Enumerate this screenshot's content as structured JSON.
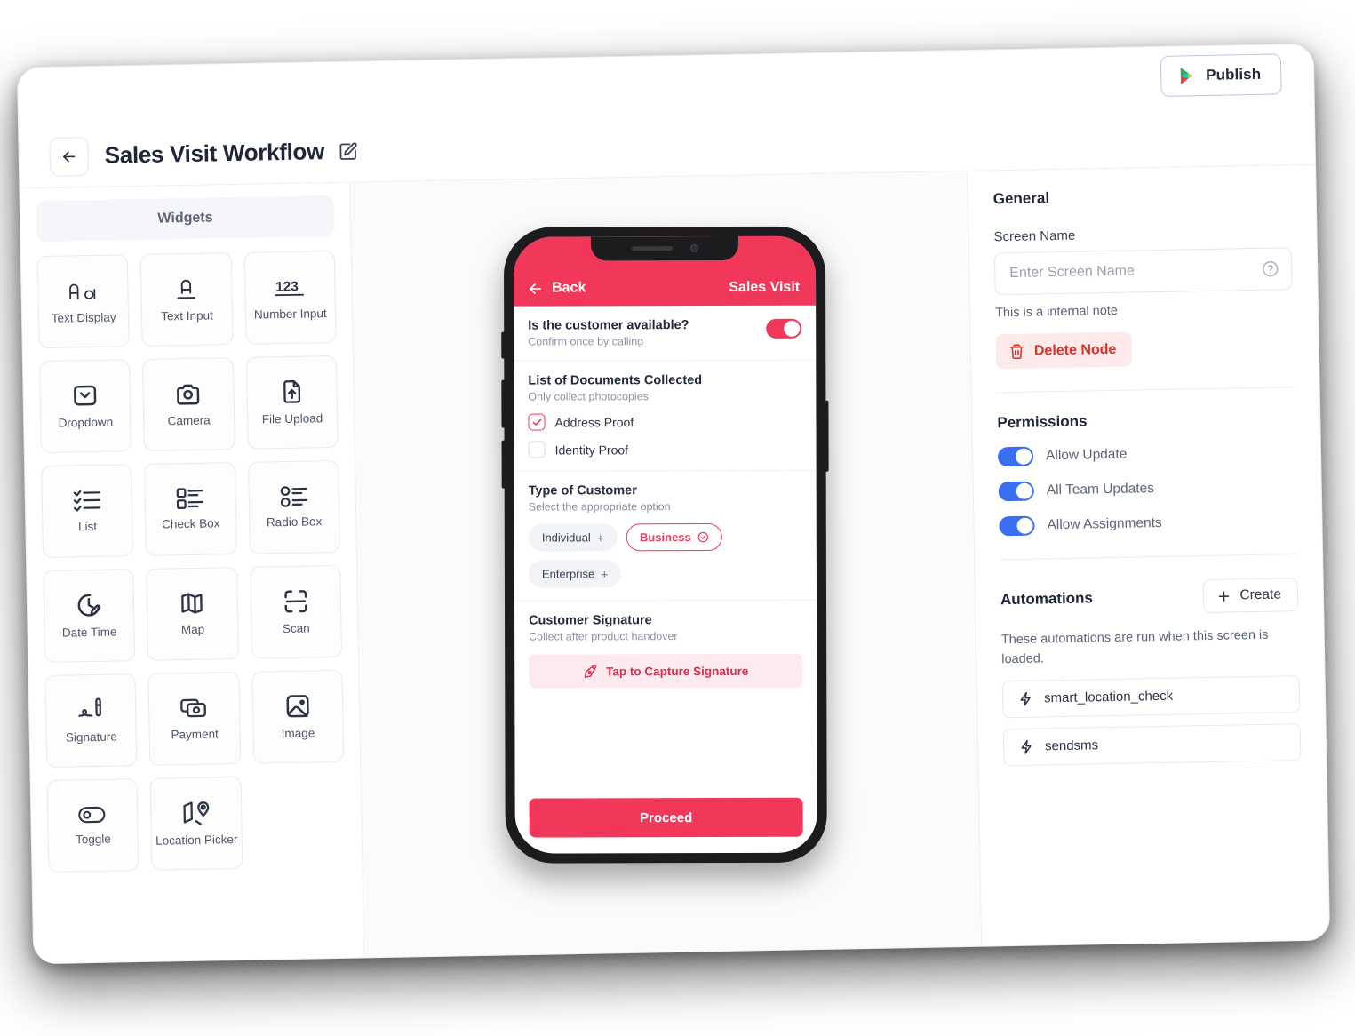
{
  "topbar": {
    "publish_label": "Publish",
    "publish_icon": "google-play-triangle-icon"
  },
  "header": {
    "back_icon": "arrow-left-icon",
    "title": "Sales Visit Workflow",
    "edit_icon": "pencil-square-icon"
  },
  "widgets_panel": {
    "header_label": "Widgets",
    "items": [
      {
        "label": "Text Display",
        "icon": "text-display-icon"
      },
      {
        "label": "Text Input",
        "icon": "text-input-icon"
      },
      {
        "label": "Number Input",
        "icon": "number-input-icon"
      },
      {
        "label": "Dropdown",
        "icon": "dropdown-icon"
      },
      {
        "label": "Camera",
        "icon": "camera-icon"
      },
      {
        "label": "File Upload",
        "icon": "file-upload-icon"
      },
      {
        "label": "List",
        "icon": "list-icon"
      },
      {
        "label": "Check Box",
        "icon": "check-box-icon"
      },
      {
        "label": "Radio Box",
        "icon": "radio-box-icon"
      },
      {
        "label": "Date Time",
        "icon": "date-time-icon"
      },
      {
        "label": "Map",
        "icon": "map-icon"
      },
      {
        "label": "Scan",
        "icon": "scan-icon"
      },
      {
        "label": "Signature",
        "icon": "signature-icon"
      },
      {
        "label": "Payment",
        "icon": "payment-icon"
      },
      {
        "label": "Image",
        "icon": "image-icon"
      },
      {
        "label": "Toggle",
        "icon": "toggle-icon"
      },
      {
        "label": "Location Picker",
        "icon": "location-picker-icon"
      }
    ]
  },
  "phone": {
    "appbar": {
      "back_label": "Back",
      "back_icon": "arrow-left-icon",
      "title": "Sales Visit"
    },
    "sections": {
      "availability": {
        "title": "Is the customer available?",
        "subtitle": "Confirm once by calling",
        "toggle_on": true
      },
      "documents": {
        "title": "List of Documents Collected",
        "subtitle": "Only collect photocopies",
        "options": [
          {
            "label": "Address Proof",
            "checked": true
          },
          {
            "label": "Identity Proof",
            "checked": false
          }
        ]
      },
      "customer_type": {
        "title": "Type of Customer",
        "subtitle": "Select the appropriate option",
        "chips": [
          {
            "label": "Individual",
            "selected": false,
            "affix": "+"
          },
          {
            "label": "Business",
            "selected": true,
            "affix": "check-circle-icon"
          },
          {
            "label": "Enterprise",
            "selected": false,
            "affix": "+"
          }
        ]
      },
      "signature": {
        "title": "Customer Signature",
        "subtitle": "Collect after product handover",
        "button_label": "Tap to Capture Signature",
        "button_icon": "pen-nib-icon"
      }
    },
    "proceed_label": "Proceed"
  },
  "inspector": {
    "general_heading": "General",
    "screen_name_label": "Screen Name",
    "screen_name_value": "",
    "screen_name_placeholder": "Enter Screen Name",
    "help_icon": "question-circle-icon",
    "note": "This is a internal note",
    "delete_label": "Delete Node",
    "delete_icon": "trash-icon",
    "permissions_heading": "Permissions",
    "permissions": [
      {
        "label": "Allow Update",
        "on": true
      },
      {
        "label": "All Team Updates",
        "on": true
      },
      {
        "label": "Allow Assignments",
        "on": true
      }
    ],
    "automations_heading": "Automations",
    "create_label": "Create",
    "create_icon": "plus-icon",
    "automations_description": "These automations are run when this screen is loaded.",
    "automations": [
      {
        "label": "smart_location_check",
        "icon": "lightning-icon"
      },
      {
        "label": "sendsms",
        "icon": "lightning-icon"
      }
    ]
  },
  "colors": {
    "accent_pink": "#F2385A",
    "toggle_blue": "#3B6FF2",
    "danger_red": "#D9342B",
    "text_dark": "#1f2638"
  }
}
